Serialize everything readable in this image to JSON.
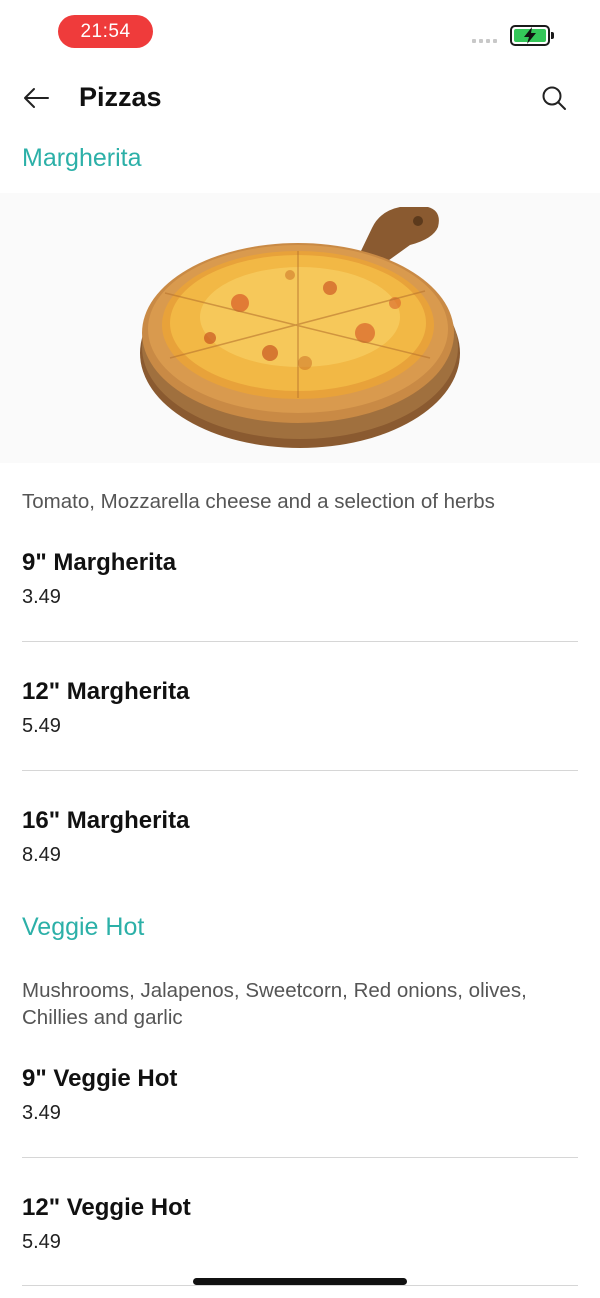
{
  "status_bar": {
    "time": "21:54",
    "battery_color": "#34c759",
    "time_pill_color": "#ef3b3b"
  },
  "header": {
    "title": "Pizzas",
    "back_icon": "arrow-left-icon",
    "search_icon": "search-icon"
  },
  "accent_color": "#2cb0a8",
  "sections": [
    {
      "title": "Margherita",
      "image": "margherita-pizza-photo",
      "description": "Tomato, Mozzarella cheese and a selection of herbs",
      "items": [
        {
          "name": "9\" Margherita",
          "price": "3.49"
        },
        {
          "name": "12\" Margherita",
          "price": "5.49"
        },
        {
          "name": "16\" Margherita",
          "price": "8.49"
        }
      ]
    },
    {
      "title": "Veggie Hot",
      "description": "Mushrooms, Jalapenos, Sweetcorn, Red onions, olives, Chillies and garlic",
      "items": [
        {
          "name": "9\" Veggie Hot",
          "price": "3.49"
        },
        {
          "name": "12\" Veggie Hot",
          "price": "5.49"
        }
      ]
    }
  ]
}
